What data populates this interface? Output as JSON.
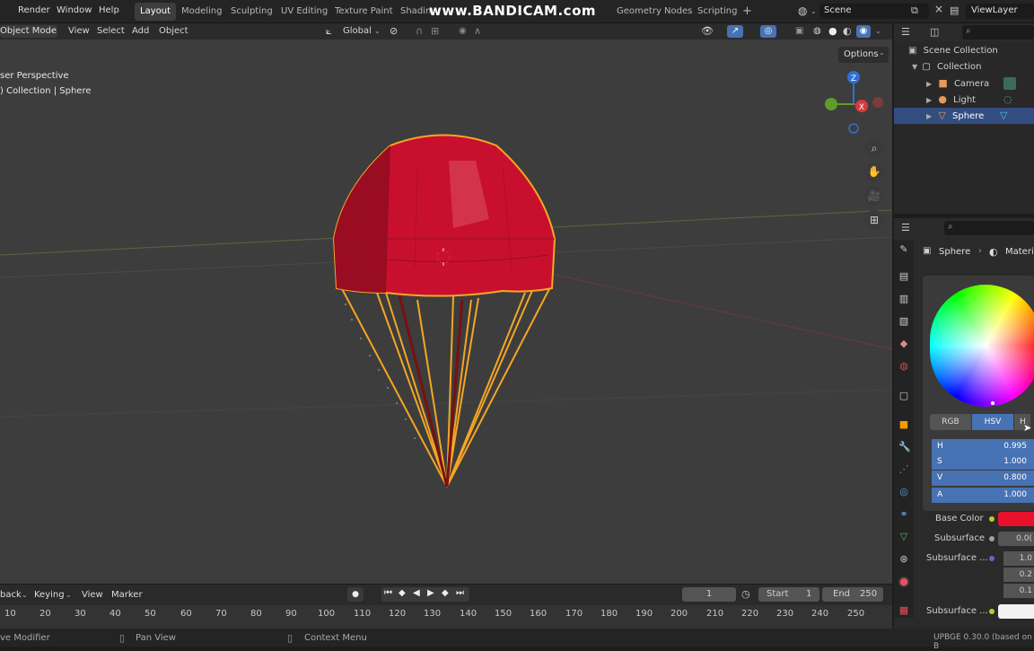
{
  "topbar": {
    "menus": [
      "Render",
      "Window",
      "Help"
    ],
    "workspaces": [
      "Layout",
      "Modeling",
      "Sculpting",
      "UV Editing",
      "Texture Paint",
      "Shadin",
      "Geometry Nodes",
      "Scripting"
    ],
    "active_workspace": "Layout",
    "add_tab": "+",
    "watermark": "www.BANDICAM.com",
    "scene_label": "Scene",
    "viewlayer_label": "ViewLayer"
  },
  "viewport_header": {
    "mode": "Object Mode",
    "menus": [
      "View",
      "Select",
      "Add",
      "Object"
    ],
    "transform": "Global",
    "options": "Options"
  },
  "viewport": {
    "perspective": "ser Perspective",
    "breadcrumb": ") Collection | Sphere",
    "gizmo_axes": [
      "Z",
      "X"
    ]
  },
  "outliner": {
    "scene_collection": "Scene Collection",
    "collection": "Collection",
    "items": [
      {
        "name": "Camera",
        "selected": false
      },
      {
        "name": "Light",
        "selected": false
      },
      {
        "name": "Sphere",
        "selected": true
      }
    ]
  },
  "properties": {
    "breadcrumb_object": "Sphere",
    "breadcrumb_material": "Materia",
    "color_modes": [
      "RGB",
      "HSV",
      "H"
    ],
    "active_color_mode": "HSV",
    "hsva": [
      {
        "label": "H",
        "value": "0.995"
      },
      {
        "label": "S",
        "value": "1.000"
      },
      {
        "label": "V",
        "value": "0.800"
      },
      {
        "label": "A",
        "value": "1.000"
      }
    ],
    "base_color_label": "Base Color",
    "base_color_hex": "#e8112a",
    "subsurface_label": "Subsurface",
    "subsurface_value": "0.0(",
    "subsurface_radius_label": "Subsurface ...",
    "subsurface_radius_values": [
      "1.0",
      "0.2",
      "0.1"
    ],
    "subsurface_color_label": "Subsurface ..."
  },
  "timeline": {
    "playback": "back",
    "keying": "Keying",
    "menus": [
      "View",
      "Marker"
    ],
    "current_frame": "1",
    "start_label": "Start",
    "start_value": "1",
    "end_label": "End",
    "end_value": "250",
    "ruler": [
      "10",
      "20",
      "30",
      "40",
      "50",
      "60",
      "70",
      "80",
      "90",
      "100",
      "110",
      "120",
      "130",
      "140",
      "150",
      "160",
      "170",
      "180",
      "190",
      "200",
      "210",
      "220",
      "230",
      "240",
      "250"
    ]
  },
  "status": {
    "left": "ve Modifier",
    "pan": "Pan View",
    "context": "Context Menu",
    "version": "UPBGE 0.30.0 (based on B"
  },
  "colors": {
    "accent": "#4772b3",
    "selection": "#f5a623",
    "material_red": "#c8102e"
  }
}
